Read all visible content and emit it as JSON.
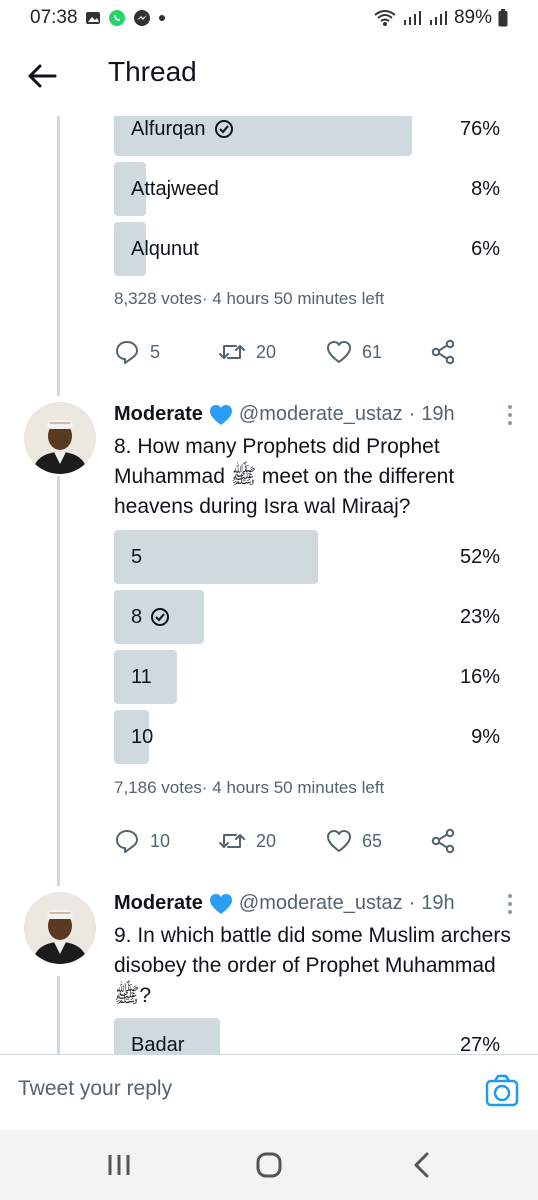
{
  "status_bar": {
    "time": "07:38",
    "battery": "89%"
  },
  "header": {
    "title": "Thread"
  },
  "poll1": {
    "options": [
      {
        "label": "Alfurqan",
        "percent": "76%",
        "fraction": 0.76,
        "correct": true
      },
      {
        "label": "Attajweed",
        "percent": "8%",
        "fraction": 0.08,
        "correct": false
      },
      {
        "label": "Alqunut",
        "percent": "6%",
        "fraction": 0.06,
        "correct": false
      }
    ],
    "votes": "8,328 votes",
    "time_left": "4 hours 50 minutes left",
    "replies": "5",
    "retweets": "20",
    "likes": "61"
  },
  "tweet8": {
    "name": "Moderate",
    "handle": "@moderate_ustaz",
    "time": "19h",
    "text": "8. How many Prophets did Prophet Muhammad ﷺ meet on the different heavens during Isra wal Miraaj?",
    "options": [
      {
        "label": "5",
        "percent": "52%",
        "fraction": 0.52,
        "correct": false
      },
      {
        "label": "8",
        "percent": "23%",
        "fraction": 0.23,
        "correct": true
      },
      {
        "label": "11",
        "percent": "16%",
        "fraction": 0.16,
        "correct": false
      },
      {
        "label": "10",
        "percent": "9%",
        "fraction": 0.09,
        "correct": false
      }
    ],
    "votes": "7,186 votes",
    "time_left": "4 hours 50 minutes left",
    "replies": "10",
    "retweets": "20",
    "likes": "65"
  },
  "tweet9": {
    "name": "Moderate",
    "handle": "@moderate_ustaz",
    "time": "19h",
    "text": "9. In which battle did some Muslim archers disobey the order of Prophet Muhammad ﷺ?",
    "options": [
      {
        "label": "Badar",
        "percent": "27%",
        "fraction": 0.27,
        "correct": false
      }
    ]
  },
  "reply_bar": {
    "placeholder": "Tweet your reply"
  },
  "colors": {
    "accent": "#1d9bf0",
    "poll_bar": "#cfd9de",
    "muted_text": "#536471",
    "heart_badge": "#2a9df4"
  },
  "icons": [
    "gallery-icon",
    "whatsapp-icon",
    "messenger-icon",
    "wifi-icon",
    "signal-icon",
    "battery-icon",
    "back-arrow-icon",
    "check-circle-icon",
    "reply-icon",
    "retweet-icon",
    "like-icon",
    "share-icon",
    "blue-heart-icon",
    "more-icon",
    "camera-icon",
    "recents-icon",
    "home-icon",
    "nav-back-icon"
  ]
}
